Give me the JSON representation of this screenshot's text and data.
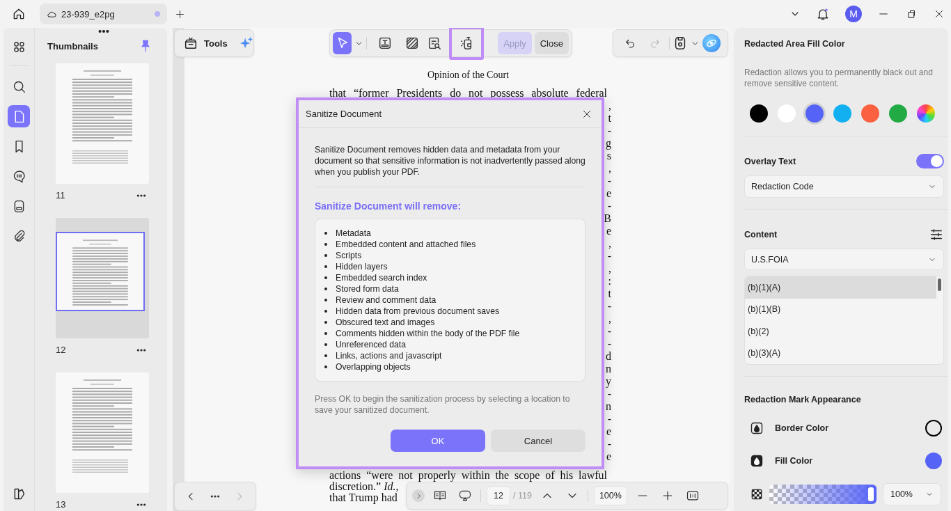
{
  "title_bar": {
    "tab": {
      "title": "23-939_e2pg",
      "modified": true
    },
    "avatar": "M"
  },
  "left_rail": {
    "items": [
      {
        "kind": "apps",
        "selected": false
      },
      {
        "kind": "search",
        "selected": false
      },
      {
        "kind": "pages",
        "selected": true
      },
      {
        "kind": "bookmarks",
        "selected": false
      },
      {
        "kind": "comments",
        "selected": false
      },
      {
        "kind": "forms",
        "selected": false
      },
      {
        "kind": "attachments",
        "selected": false
      }
    ]
  },
  "thumbnails": {
    "title": "Thumbnails",
    "pages": [
      {
        "label": "11",
        "selected": false
      },
      {
        "label": "12",
        "selected": true
      },
      {
        "label": "13",
        "selected": false
      }
    ]
  },
  "toolbar": {
    "tools_label": "Tools",
    "tools": [
      {
        "kind": "select",
        "selected": true,
        "highlighted": false
      },
      {
        "kind": "redact-text",
        "selected": false,
        "highlighted": false
      },
      {
        "kind": "redact-area",
        "selected": false,
        "highlighted": false
      },
      {
        "kind": "search-redact",
        "selected": false,
        "highlighted": false
      },
      {
        "kind": "sanitize",
        "selected": false,
        "highlighted": true
      }
    ],
    "apply": {
      "label": "Apply",
      "disabled": true
    },
    "close": {
      "label": "Close"
    },
    "undo": {
      "disabled": false
    },
    "redo": {
      "disabled": true
    }
  },
  "document": {
    "header": "Opinion of the Court",
    "lines_top": [
      "that “former Presidents do not possess absolute federal"
    ],
    "fragments": [
      ",",
      "t",
      "-",
      "g",
      "s",
      ",",
      "-",
      "e",
      "-",
      "B",
      "e",
      ",",
      "-",
      ",",
      ":",
      "t",
      "-",
      ",",
      "-",
      "-",
      "d",
      "n",
      "y",
      "-",
      "n",
      "-",
      "e",
      "-",
      "e"
    ],
    "lines_bottom": [
      "actions “were not properly within the scope of his lawful",
      "discretion.” *Id.*,",
      "that Trump had"
    ]
  },
  "dialog": {
    "title": "Sanitize Document",
    "highlighted": true,
    "intro": "Sanitize Document removes hidden data and metadata from your document so that sensitive information is not inadvertently passed along when you publish your PDF.",
    "heading": "Sanitize Document will remove:",
    "items": [
      "Metadata",
      "Embedded content and attached files",
      "Scripts",
      "Hidden layers",
      "Embedded search index",
      "Stored form data",
      "Review and comment data",
      "Hidden data from previous document saves",
      "Obscured text and images",
      "Comments hidden within the body of the PDF file",
      "Unreferenced data",
      "Links, actions and javascript",
      "Overlapping objects"
    ],
    "note": "Press OK to begin the sanitization process by selecting a location to save your sanitized document.",
    "ok": "OK",
    "cancel": "Cancel"
  },
  "bottom_nav": {
    "prev": {
      "disabled": false
    },
    "next": {
      "disabled": true
    }
  },
  "page_nav": {
    "page": "12",
    "total": "/ 119",
    "zoom": "100%"
  },
  "right_panel": {
    "fill_title": "Redacted Area Fill Color",
    "fill_desc": "Redaction allows you to permanently black out and remove sensitive content.",
    "swatches": [
      {
        "kind": "solid",
        "color": "#000000",
        "selected": false
      },
      {
        "kind": "solid",
        "color": "#ffffff",
        "selected": false
      },
      {
        "kind": "solid",
        "color": "#5563f7",
        "selected": true
      },
      {
        "kind": "solid",
        "color": "#12b0f0",
        "selected": false
      },
      {
        "kind": "solid",
        "color": "#fb6140",
        "selected": false
      },
      {
        "kind": "solid",
        "color": "#22aa44",
        "selected": false
      },
      {
        "kind": "custom",
        "selected": false
      }
    ],
    "overlay_title": "Overlay Text",
    "overlay_on": true,
    "overlay_select": "Redaction Code",
    "content_title": "Content",
    "content_select": "U.S.FOIA",
    "codes": [
      {
        "label": "(b)(1)(A)",
        "selected": true
      },
      {
        "label": "(b)(1)(B)",
        "selected": false
      },
      {
        "label": "(b)(2)",
        "selected": false
      },
      {
        "label": "(b)(3)(A)",
        "selected": false
      }
    ],
    "appearance_title": "Redaction Mark Appearance",
    "border": {
      "label": "Border Color",
      "color": "#000000"
    },
    "fill": {
      "label": "Fill Color",
      "color": "#5563f7"
    },
    "opacity": {
      "level": 1,
      "value": "100%"
    }
  }
}
